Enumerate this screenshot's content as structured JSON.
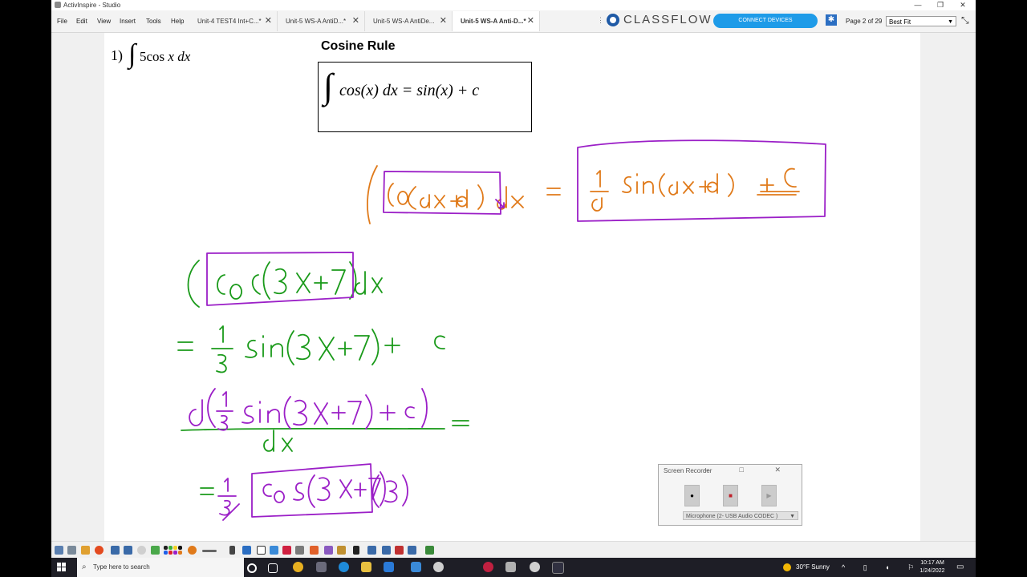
{
  "window": {
    "title": "ActivInspire - Studio"
  },
  "menu": [
    "File",
    "Edit",
    "View",
    "Insert",
    "Tools",
    "Help"
  ],
  "tabs": [
    {
      "label": "Unit-4 TEST4 Int+C...*",
      "active": false
    },
    {
      "label": "Unit-5 WS-A AntiD...*",
      "active": false
    },
    {
      "label": "Unit-5 WS-A AntiDe...",
      "active": false
    },
    {
      "label": "Unit-5 WS-A Anti-D...*",
      "active": true
    }
  ],
  "classflow": {
    "brand": "CLASSFLOW",
    "connect_label": "CONNECT DEVICES",
    "accent": "#1e9be8"
  },
  "page": {
    "indicator": "Page 2 of 29",
    "zoom": "Best Fit"
  },
  "flipchart": {
    "problem_number": "1)",
    "problem_integral": "∫",
    "problem_coef": "5cos",
    "problem_var": "x",
    "problem_dx": "dx",
    "rule_title": "Cosine Rule",
    "rule_integral": "∫",
    "rule_formula": "cos(x) dx = sin(x) + c",
    "ink_colors": {
      "orange": "#e07a1a",
      "purple": "#9b1fc7",
      "green": "#1a9a1a"
    }
  },
  "screen_recorder": {
    "title": "Screen Recorder",
    "microphone": "Microphone (2- USB Audio CODEC )"
  },
  "taskbar": {
    "search_placeholder": "Type here to search",
    "weather": "30°F  Sunny",
    "time": "10:17 AM",
    "date": "1/24/2022"
  }
}
